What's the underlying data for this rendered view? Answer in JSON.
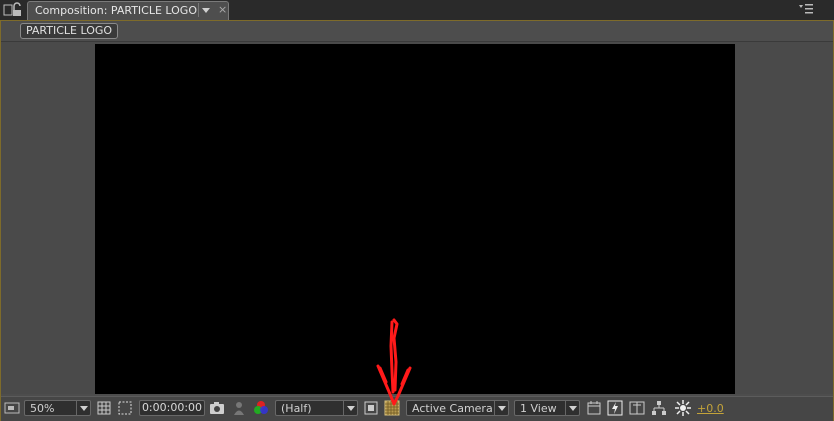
{
  "window": {
    "tab_title": "Composition: PARTICLE LOGO",
    "tab_close_glyph": "×"
  },
  "comp_nav": {
    "label": "PARTICLE LOGO"
  },
  "viewer": {
    "background": "#000000"
  },
  "toolbar": {
    "magnification": "50%",
    "timecode": "0:00:00:00",
    "resolution": "(Half)",
    "camera": "Active Camera",
    "view_layout": "1 View",
    "exposure": "+0.0"
  },
  "colors": {
    "panel": "#4d4d4d",
    "panel_border": "#7e6b2a",
    "accent_exposure": "#c3a33a",
    "annotation": "#ff1a1a"
  },
  "icons": {
    "lock": "lock-icon",
    "panel_menu": "panel-menu-icon",
    "always_preview": "always-preview-icon",
    "grid": "grid-icon",
    "region": "region-of-interest-icon",
    "snapshot": "camera-snapshot-icon",
    "show_snapshot": "show-snapshot-icon",
    "channel": "rgb-channel-icon",
    "fast_preview_box": "target-region-icon",
    "transparency": "transparency-grid-icon",
    "timeline": "timeline-icon",
    "fast_previews": "fast-previews-icon",
    "flowchart": "flowchart-icon",
    "reset_exposure": "reset-exposure-icon"
  }
}
